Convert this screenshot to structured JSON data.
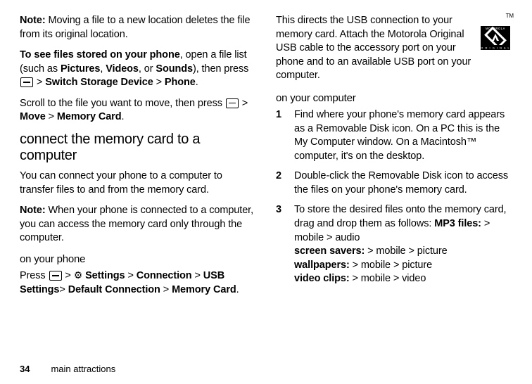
{
  "left": {
    "note1_label": "Note:",
    "note1_text": " Moving a file to a new location deletes the file from its original location.",
    "seeFiles_lead": "To see files stored on your phone",
    "seeFiles_mid1": ", open a file list (such as ",
    "seeFiles_pictures": "Pictures",
    "seeFiles_comma1": ", ",
    "seeFiles_videos": "Videos",
    "seeFiles_comma2": ", or ",
    "seeFiles_sounds": "Sounds",
    "seeFiles_mid2": "), then press ",
    "seeFiles_gt1": " > ",
    "seeFiles_switch": "Switch Storage Device",
    "seeFiles_gt2": " > ",
    "seeFiles_phone": "Phone",
    "seeFiles_period": ".",
    "scroll_text": "Scroll to the file you want to move, then press ",
    "scroll_gt1": " > ",
    "scroll_move": "Move",
    "scroll_gt2": " > ",
    "scroll_memcard": "Memory Card",
    "scroll_period": ".",
    "heading_connect": "connect the memory card to a computer",
    "connect_intro": "You can connect your phone to a computer to transfer files to and from the memory card.",
    "note2_label": "Note:",
    "note2_text": " When your phone is connected to a computer, you can access the memory card only through the computer.",
    "sub_onphone": "on your phone",
    "press_label": "Press ",
    "press_gt1": " > ",
    "press_settings": " Settings",
    "press_gt2": " > ",
    "press_connection": "Connection",
    "press_gt3": " > ",
    "press_usb": "USB Settings",
    "press_gt4": "> ",
    "press_default": "Default Connection",
    "press_gt5": " > ",
    "press_memcard": "Memory Card",
    "press_period": "."
  },
  "right": {
    "top_text": "This directs the USB connection to your memory card. Attach the Motorola Original USB cable to the accessory port on your phone and to an available USB port on your computer.",
    "logo_top": "MOTOROLA",
    "logo_bottom": "O R I G I N A L",
    "tm": "TM",
    "sub_oncomputer": "on your computer",
    "step1": "Find where your phone's memory card appears as a Removable Disk icon. On a PC this is the My Computer window. On a Macintosh™ computer, it's on the desktop.",
    "step2": "Double-click the Removable Disk icon to access the files on your phone's memory card.",
    "step3_a": "To store the desired files onto the memory card, drag and drop them as follows: ",
    "step3_mp3": "MP3 files:",
    "step3_mp3_path": " > mobile > audio",
    "step3_ss": "screen savers:",
    "step3_ss_path": " > mobile > picture",
    "step3_wp": "wallpapers:",
    "step3_wp_path": " > mobile > picture",
    "step3_vc": "video clips:",
    "step3_vc_path": " > mobile > video"
  },
  "footer": {
    "page": "34",
    "section": "main attractions"
  }
}
